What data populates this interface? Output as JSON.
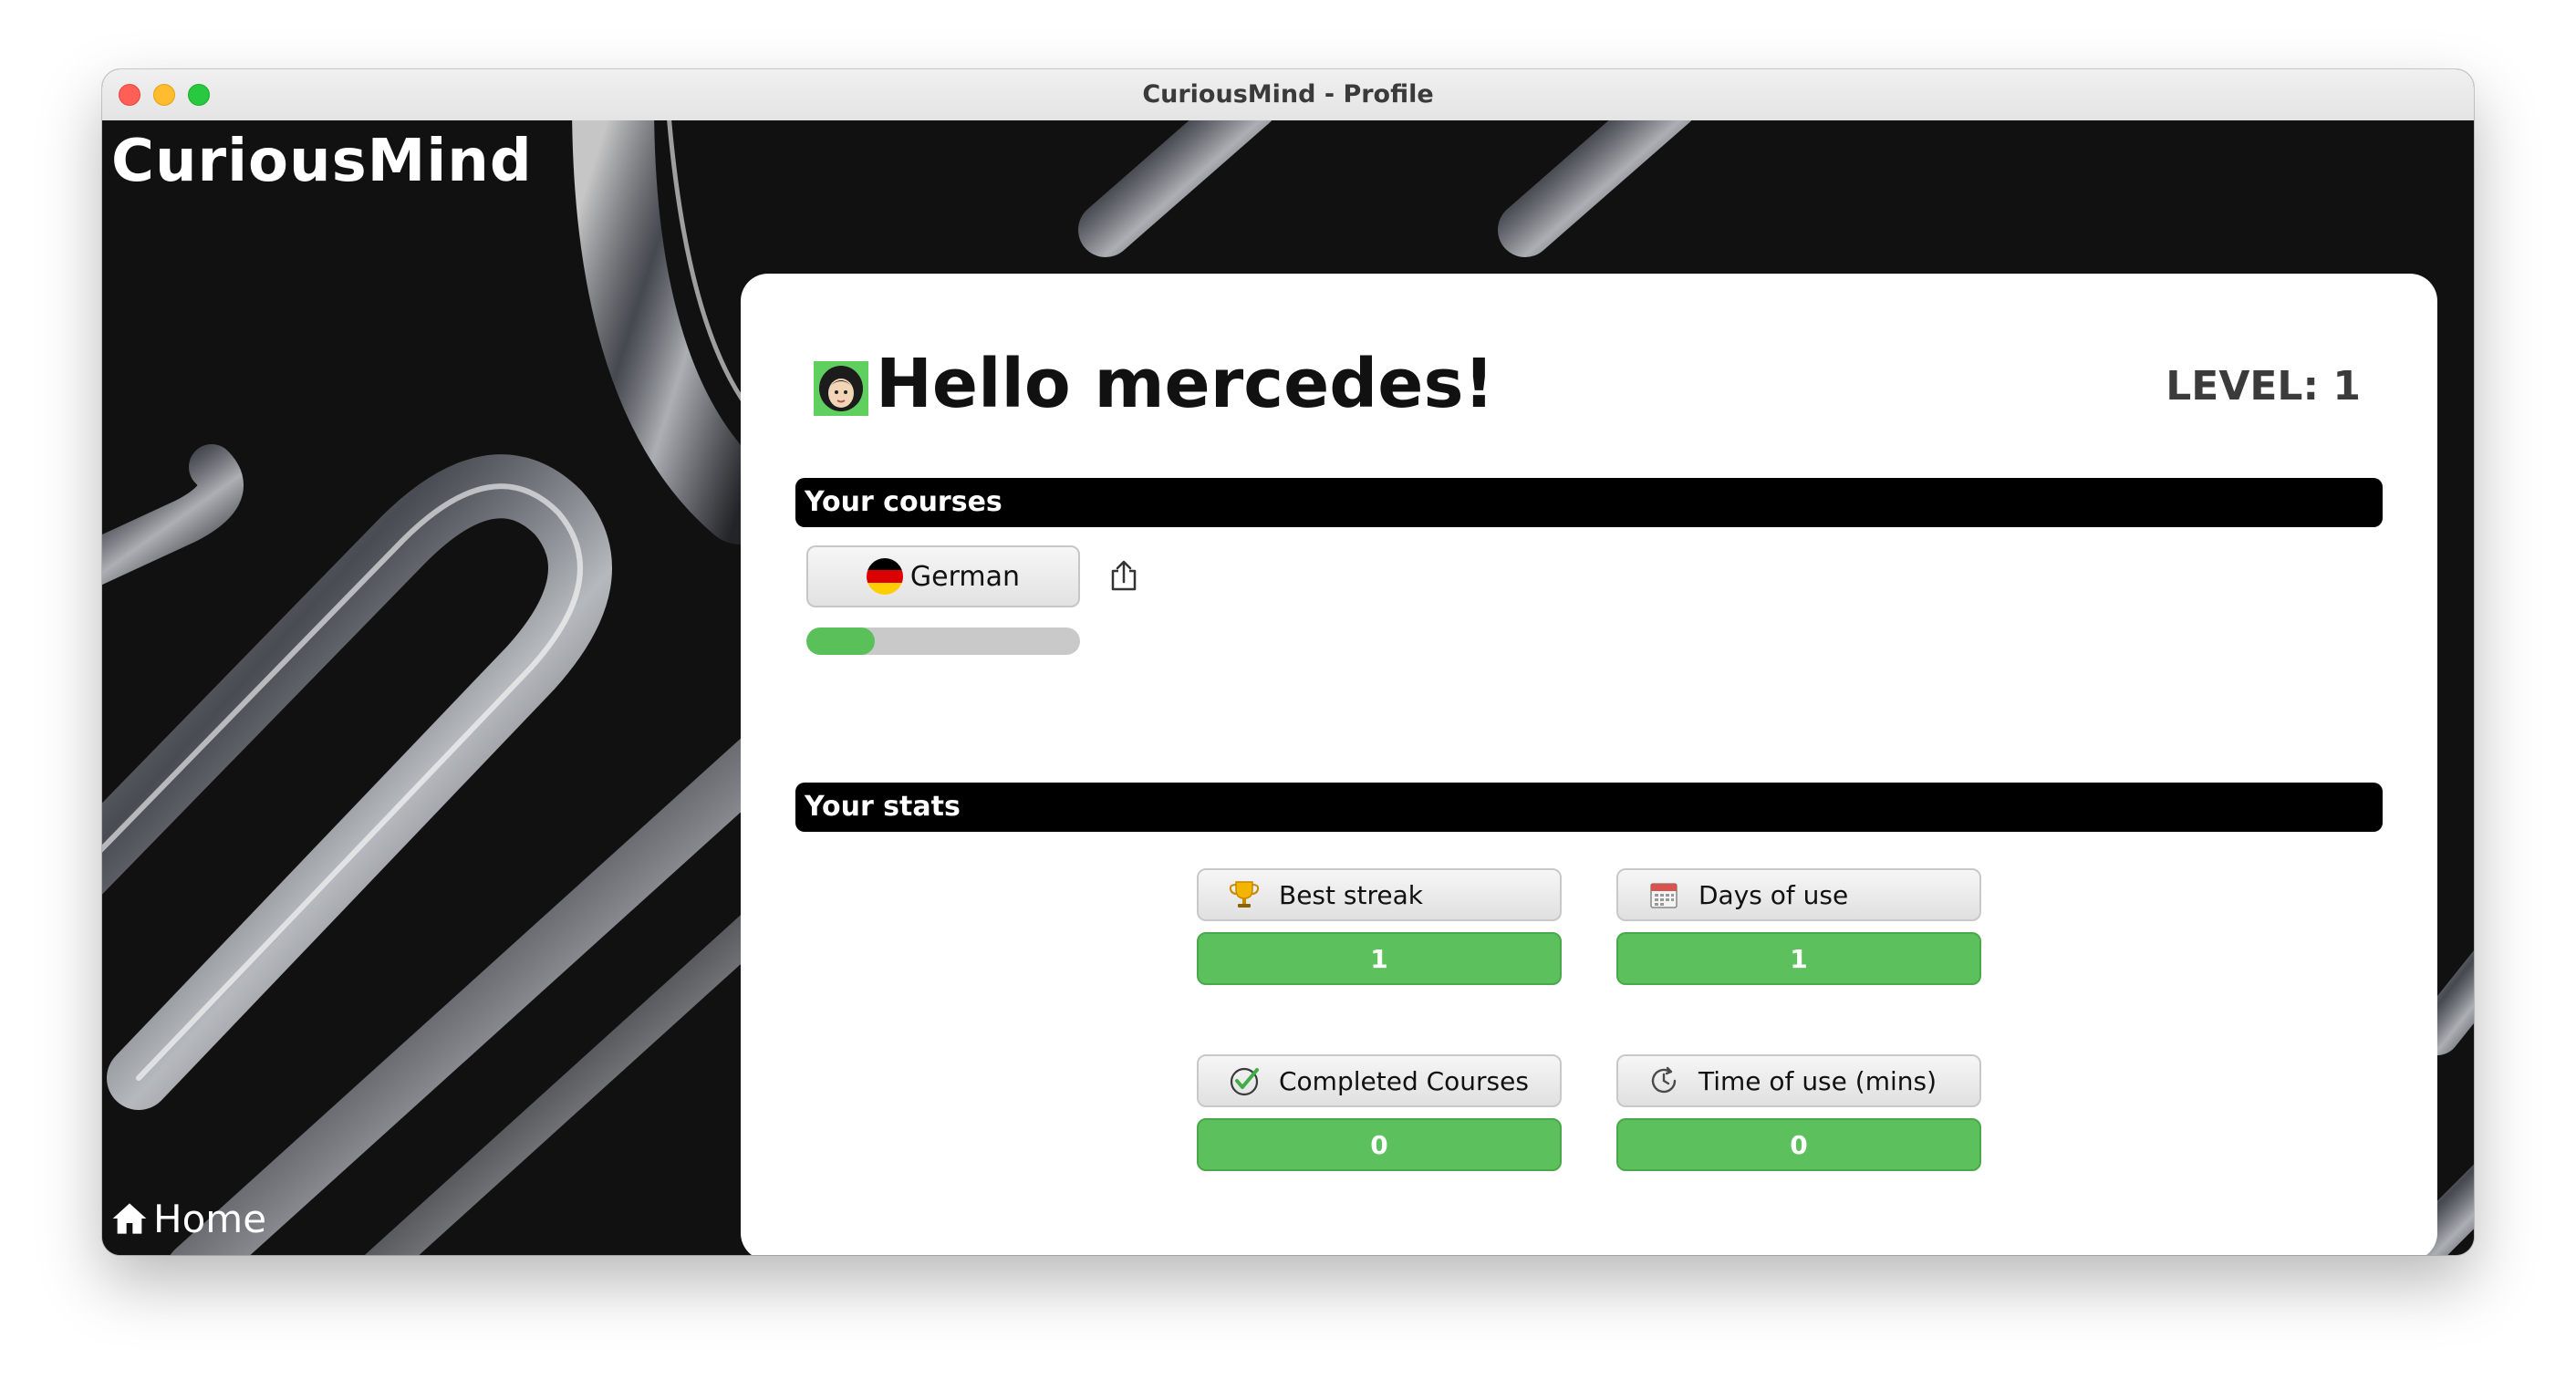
{
  "window": {
    "title": "CuriousMind - Profile"
  },
  "app": {
    "brand": "CuriousMind",
    "home_label": "Home"
  },
  "profile": {
    "greeting": "Hello mercedes!",
    "level_text": "LEVEL: 1",
    "avatar_icon": "avatar-face-icon"
  },
  "courses": {
    "section_title": "Your courses",
    "items": [
      {
        "label": "German",
        "flag_icon": "germany-flag-icon",
        "progress_percent": 25
      }
    ],
    "share_icon": "share-icon"
  },
  "stats": {
    "section_title": "Your stats",
    "items": [
      {
        "label": "Best streak",
        "value": "1",
        "icon": "trophy-icon"
      },
      {
        "label": "Days of use",
        "value": "1",
        "icon": "calendar-icon"
      },
      {
        "label": "Completed Courses",
        "value": "0",
        "icon": "check-circle-icon"
      },
      {
        "label": "Time of use (mins)",
        "value": "0",
        "icon": "clock-icon"
      }
    ]
  },
  "colors": {
    "accent_green": "#5cc15c",
    "background": "#111111",
    "section_bar": "#000000"
  }
}
